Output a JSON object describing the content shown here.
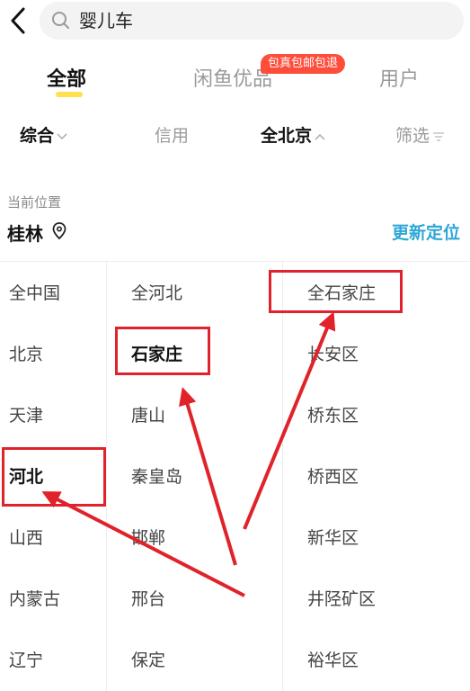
{
  "search": {
    "query": "婴儿车"
  },
  "tabs": [
    {
      "label": "全部",
      "active": true
    },
    {
      "label": "闲鱼优品",
      "active": false
    },
    {
      "label": "用户",
      "active": false
    }
  ],
  "badge": "包真包邮包退",
  "filters": {
    "sort": "综合",
    "credit": "信用",
    "region": "全北京",
    "filter": "筛选"
  },
  "location": {
    "label": "当前位置",
    "city": "桂林",
    "relocate": "更新定位"
  },
  "provinces": [
    "全中国",
    "北京",
    "天津",
    "河北",
    "山西",
    "内蒙古",
    "辽宁"
  ],
  "cities": [
    "全河北",
    "石家庄",
    "唐山",
    "秦皇岛",
    "邯郸",
    "邢台",
    "保定"
  ],
  "districts": [
    "全石家庄",
    "长安区",
    "桥东区",
    "桥西区",
    "新华区",
    "井陉矿区",
    "裕华区"
  ],
  "selected": {
    "province": "河北",
    "city": "石家庄",
    "district": "全石家庄"
  },
  "colors": {
    "accent_blue": "#2ea7d6",
    "annotation_red": "#e0232a",
    "tab_underline": "#ffe04d",
    "badge": "#ff4d3b"
  }
}
